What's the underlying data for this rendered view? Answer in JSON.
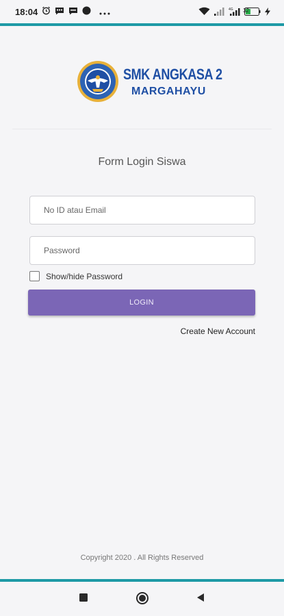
{
  "status_bar": {
    "time": "18:04",
    "battery": "32"
  },
  "header": {
    "school_name": "SMK ANGKASA 2",
    "school_town": "MARGAHAYU"
  },
  "form": {
    "title": "Form Login Siswa",
    "email_placeholder": "No ID atau Email",
    "password_placeholder": "Password",
    "show_password_label": "Show/hide Password",
    "show_password_checked": false,
    "login_label": "LOGIN",
    "create_account_label": "Create New Account"
  },
  "footer": {
    "copyright": "Copyright 2020 . All Rights Reserved"
  },
  "colors": {
    "accent": "#1e9aa6",
    "button": "#7b66b6",
    "brand": "#1f4fa4"
  },
  "icons": {
    "status_left": [
      "alarm-icon",
      "message-icon",
      "message-icon",
      "circle-icon",
      "more-icon"
    ],
    "status_right": [
      "wifi-icon",
      "signal-icon",
      "signal-4g-icon",
      "battery-icon",
      "charging-icon"
    ],
    "nav": [
      "recents-icon",
      "home-icon",
      "back-icon"
    ]
  }
}
